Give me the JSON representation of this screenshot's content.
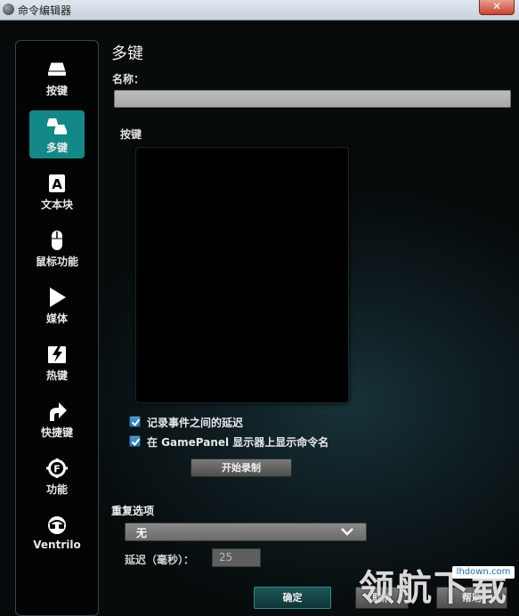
{
  "window": {
    "title": "命令编辑器",
    "close_glyph": "✕"
  },
  "sidebar": {
    "items": [
      {
        "label": "按键",
        "icon": "key-icon",
        "active": false
      },
      {
        "label": "多键",
        "icon": "multikey-icon",
        "active": true
      },
      {
        "label": "文本块",
        "icon": "text-block-icon",
        "active": false
      },
      {
        "label": "鼠标功能",
        "icon": "mouse-icon",
        "active": false
      },
      {
        "label": "媒体",
        "icon": "play-icon",
        "active": false
      },
      {
        "label": "热键",
        "icon": "hotkey-icon",
        "active": false
      },
      {
        "label": "快捷键",
        "icon": "shortcut-arrow-icon",
        "active": false
      },
      {
        "label": "功能",
        "icon": "function-gear-icon",
        "active": false
      },
      {
        "label": "Ventrilo",
        "icon": "ventrilo-headset-icon",
        "active": false
      }
    ]
  },
  "main": {
    "title": "多键",
    "name_label": "名称：",
    "name_value": "",
    "keys_label": "按键",
    "checkboxes": [
      {
        "label": "记录事件之间的延迟",
        "checked": true
      },
      {
        "label": "在 GamePanel 显示器上显示命令名",
        "checked": true
      }
    ],
    "record_button": "开始录制",
    "repeat": {
      "title": "重复选项",
      "selected": "无",
      "delay_label": "延迟（毫秒）：",
      "delay_value": "25"
    }
  },
  "footer": {
    "ok": "确定",
    "cancel": "取消",
    "help": "帮助"
  },
  "watermark": {
    "text": "领航下载",
    "url": "lhdown.com"
  },
  "colors": {
    "accent": "#138888",
    "background": "#0c1012",
    "sidebar": "#020303"
  }
}
